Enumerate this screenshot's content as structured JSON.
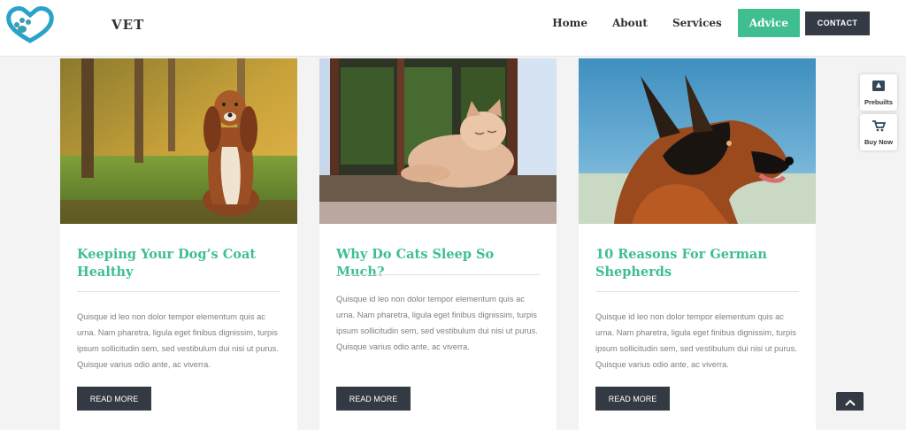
{
  "header": {
    "brand": "VET",
    "nav": [
      "Home",
      "About",
      "Services",
      "Advice"
    ],
    "active_nav": "Advice",
    "contact_label": "CONTACT"
  },
  "colors": {
    "accent": "#3fbf8f",
    "dark_button": "#343a43",
    "logo_blue": "#2aa3c8"
  },
  "icons": {
    "logo": "paw-heart-logo",
    "prebuilts": "box-icon",
    "buy_now": "cart-icon",
    "to_top": "chevron-up-icon"
  },
  "cards": [
    {
      "image": "king-charles-spaniel-photo",
      "title": "Keeping Your Dog’s Coat Healthy",
      "excerpt": "Quisque id leo non dolor tempor elementum quis ac urna. Nam pharetra, ligula eget finibus dignissim, turpis ipsum sollicitudin sem, sed vestibulum dui nisi ut purus. Quisque varius odio ante, ac viverra.",
      "button": "READ MORE"
    },
    {
      "image": "sleeping-cat-photo",
      "title": "Why Do Cats Sleep So Much?",
      "excerpt": "Quisque id leo non dolor tempor elementum quis ac urna. Nam pharetra, ligula eget finibus dignissim, turpis ipsum sollicitudin sem, sed vestibulum dui nisi ut purus. Quisque varius odio ante, ac viverra.",
      "button": "READ MORE"
    },
    {
      "image": "german-shepherd-photo",
      "title": "10 Reasons For German Shepherds",
      "excerpt": "Quisque id leo non dolor tempor elementum quis ac urna. Nam pharetra, ligula eget finibus dignissim, turpis ipsum sollicitudin sem, sed vestibulum dui nisi ut purus. Quisque varius odio ante, ac viverra.",
      "button": "READ MORE"
    }
  ],
  "side_panel": {
    "prebuilts_label": "Prebuilts",
    "buy_now_label": "Buy Now"
  }
}
